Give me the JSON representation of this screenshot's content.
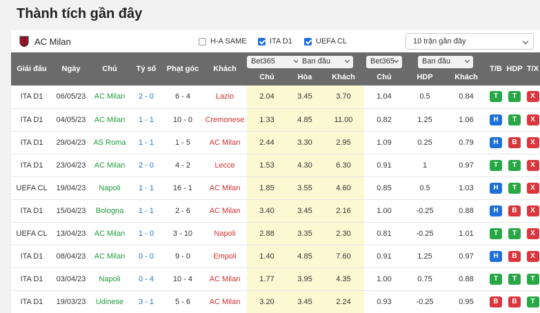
{
  "page_title": "Thành tích gần đây",
  "team": {
    "name": "AC Milan"
  },
  "filters": [
    {
      "label": "H-A SAME",
      "checked": false
    },
    {
      "label": "ITA D1",
      "checked": true
    },
    {
      "label": "UEFA CL",
      "checked": true
    }
  ],
  "count_select": {
    "value": "10 trận gần đây"
  },
  "header": {
    "giai_dau": "Giải đấu",
    "ngay": "Ngày",
    "chu": "Chủ",
    "ty_so": "Tỷ số",
    "phat_goc": "Phạt góc",
    "khach": "Khách",
    "bookmaker1": "Bet365",
    "type1": "Ban đầu",
    "bookmaker2": "Bet365",
    "type2": "Ban đầu",
    "tb": "T/B",
    "hdp": "HDP",
    "tx": "T/X",
    "sub_chu": "Chủ",
    "sub_hoa": "Hòa",
    "sub_khach": "Khách",
    "sub_chu2": "Chủ",
    "sub_hdp": "HDP",
    "sub_khach2": "Khách"
  },
  "colors": {
    "header_bg": "#6b6b6b",
    "green": "#1e9c3c",
    "blue": "#1e6fd9",
    "red": "#d32f2f",
    "odds_bg": "#fbf8d2"
  },
  "rows": [
    {
      "league": "ITA D1",
      "date": "06/05/23",
      "home": "AC Milan",
      "home_color": "green",
      "score": "2 - 0",
      "corners": "6 - 4",
      "away": "Lazio",
      "away_color": "red",
      "o_home": "2.04",
      "o_draw": "3.45",
      "o_away": "3.70",
      "h_home": "1.04",
      "hdp": "0.5",
      "h_away": "0.84",
      "tb": "T",
      "hdp_r": "T",
      "tx": "X"
    },
    {
      "league": "ITA D1",
      "date": "04/05/23",
      "home": "AC Milan",
      "home_color": "green",
      "score": "1 - 1",
      "corners": "10 - 0",
      "away": "Cremonese",
      "away_color": "red",
      "o_home": "1.33",
      "o_draw": "4.85",
      "o_away": "11.00",
      "h_home": "0.82",
      "hdp": "1.25",
      "h_away": "1.06",
      "tb": "H",
      "hdp_r": "T",
      "tx": "X"
    },
    {
      "league": "ITA D1",
      "date": "29/04/23",
      "home": "AS Roma",
      "home_color": "green",
      "score": "1 - 1",
      "corners": "1 - 5",
      "away": "AC Milan",
      "away_color": "red",
      "o_home": "2.44",
      "o_draw": "3.30",
      "o_away": "2.95",
      "h_home": "1.09",
      "hdp": "0.25",
      "h_away": "0.79",
      "tb": "H",
      "hdp_r": "B",
      "tx": "X"
    },
    {
      "league": "ITA D1",
      "date": "23/04/23",
      "home": "AC Milan",
      "home_color": "green",
      "score": "2 - 0",
      "corners": "4 - 2",
      "away": "Lecce",
      "away_color": "red",
      "o_home": "1.53",
      "o_draw": "4.30",
      "o_away": "6.30",
      "h_home": "0.91",
      "hdp": "1",
      "h_away": "0.97",
      "tb": "T",
      "hdp_r": "T",
      "tx": "X"
    },
    {
      "league": "UEFA CL",
      "date": "19/04/23",
      "home": "Napoli",
      "home_color": "green",
      "score": "1 - 1",
      "corners": "16 - 1",
      "away": "AC Milan",
      "away_color": "red",
      "o_home": "1.85",
      "o_draw": "3.55",
      "o_away": "4.60",
      "h_home": "0.85",
      "hdp": "0.5",
      "h_away": "1.03",
      "tb": "H",
      "hdp_r": "T",
      "tx": "X"
    },
    {
      "league": "ITA D1",
      "date": "15/04/23",
      "home": "Bologna",
      "home_color": "green",
      "score": "1 - 1",
      "corners": "2 - 6",
      "away": "AC Milan",
      "away_color": "red",
      "o_home": "3.40",
      "o_draw": "3.45",
      "o_away": "2.16",
      "h_home": "1.00",
      "hdp": "-0.25",
      "h_away": "0.88",
      "tb": "H",
      "hdp_r": "B",
      "tx": "X"
    },
    {
      "league": "UEFA CL",
      "date": "13/04/23",
      "home": "AC Milan",
      "home_color": "green",
      "score": "1 - 0",
      "corners": "3 - 10",
      "away": "Napoli",
      "away_color": "red",
      "o_home": "2.88",
      "o_draw": "3.35",
      "o_away": "2.30",
      "h_home": "0.81",
      "hdp": "-0.25",
      "h_away": "1.01",
      "tb": "T",
      "hdp_r": "T",
      "tx": "X"
    },
    {
      "league": "ITA D1",
      "date": "08/04/23",
      "home": "AC Milan",
      "home_color": "green",
      "score": "0 - 0",
      "corners": "9 - 0",
      "away": "Empoli",
      "away_color": "red",
      "o_home": "1.40",
      "o_draw": "4.85",
      "o_away": "7.60",
      "h_home": "0.91",
      "hdp": "1.25",
      "h_away": "0.97",
      "tb": "H",
      "hdp_r": "B",
      "tx": "X"
    },
    {
      "league": "ITA D1",
      "date": "03/04/23",
      "home": "Napoli",
      "home_color": "green",
      "score": "0 - 4",
      "corners": "10 - 4",
      "away": "AC Milan",
      "away_color": "red",
      "o_home": "1.77",
      "o_draw": "3.95",
      "o_away": "4.35",
      "h_home": "1.00",
      "hdp": "0.75",
      "h_away": "0.88",
      "tb": "T",
      "hdp_r": "T",
      "tx": "T"
    },
    {
      "league": "ITA D1",
      "date": "19/03/23",
      "home": "Udinese",
      "home_color": "green",
      "score": "3 - 1",
      "corners": "5 - 6",
      "away": "AC Milan",
      "away_color": "red",
      "o_home": "3.20",
      "o_draw": "3.45",
      "o_away": "2.24",
      "h_home": "0.93",
      "hdp": "-0.25",
      "h_away": "0.95",
      "tb": "B",
      "hdp_r": "B",
      "tx": "T"
    }
  ]
}
